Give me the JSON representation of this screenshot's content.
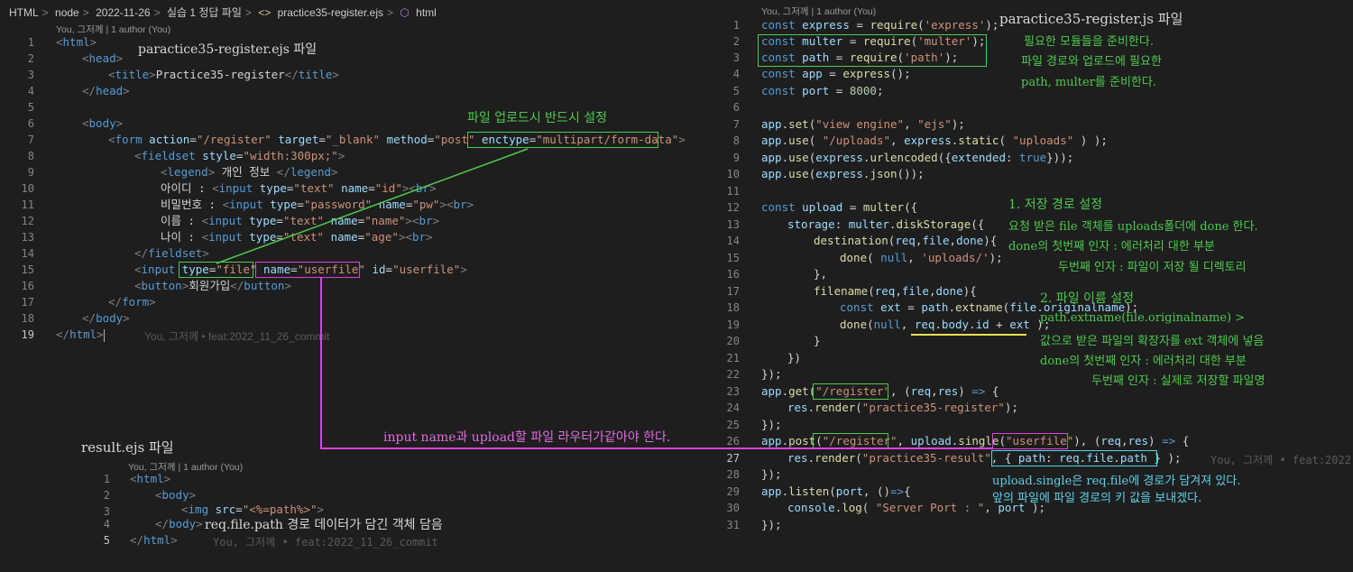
{
  "breadcrumb": {
    "items": [
      "HTML",
      "node",
      "2022-11-26",
      "실습 1 정답 파일",
      "practice35-register.ejs",
      "html"
    ],
    "separator": ">"
  },
  "blame": {
    "header": "You, 그저께 | 1 author (You)",
    "inline": "You, 그저께 • feat:2022_11_26_commit",
    "inline_short": "You, 그저께 • feat:2022"
  },
  "left": {
    "line_numbers": [
      "1",
      "2",
      "3",
      "4",
      "5",
      "6",
      "7",
      "8",
      "9",
      "10",
      "11",
      "12",
      "13",
      "14",
      "15",
      "16",
      "17",
      "18",
      "19"
    ]
  },
  "right": {
    "line_numbers": [
      "1",
      "2",
      "3",
      "4",
      "5",
      "6",
      "7",
      "8",
      "9",
      "10",
      "11",
      "12",
      "13",
      "14",
      "15",
      "16",
      "17",
      "18",
      "19",
      "20",
      "21",
      "22",
      "23",
      "24",
      "25",
      "26",
      "27",
      "28",
      "29",
      "30",
      "31"
    ]
  },
  "result": {
    "title": "result.ejs 파일",
    "line_numbers": [
      "1",
      "2",
      "3",
      "4",
      "5"
    ]
  },
  "notes": {
    "ejs_file": "paractice35-register.ejs 파일",
    "enctype_note": "파일 업로드시 반드시 설정",
    "js_file": "paractice35-register.js 파일",
    "js_desc_1": "필요한 모듈들을 준비한다.",
    "js_desc_2": "파일 경로와 업로드에 필요한",
    "js_desc_3": "path, multer를 준비한다.",
    "storage_1": "1. 저장 경로 설정",
    "storage_2": "요청 받은 file 객체를 uploads폴더에 done 한다.",
    "storage_3": "done의 첫번째 인자 : 에러처리 대한 부분",
    "storage_4": "두번째 인자 : 파일이 저장 될 디렉토리",
    "filename_1": "2. 파일 이름 설정",
    "filename_2": "path.extname(file.originalname) >",
    "filename_3": "값으로 받은 파일의 확장자를 ext 객체에 넣음",
    "filename_4": "done의 첫번째 인자 : 에러처리 대한 부분",
    "filename_5": "두번째 인자 : 실제로 저장할 파일명",
    "router_note": "input name과 upload할 파일 라우터가같아야 한다.",
    "single_1": "upload.single은 req.file에 경로가 담겨져 있다.",
    "single_2": "앞의 파일에 파일 경로의 키 값을 보내겠다.",
    "result_note": "req.file.path 경로 데이터가 담긴 객체 담음"
  },
  "colors": {
    "green": "#4ec94e",
    "magenta": "#e040e0",
    "cyan": "#4fd6ef",
    "yellow": "#e8e050",
    "background": "#1e1e1e"
  }
}
